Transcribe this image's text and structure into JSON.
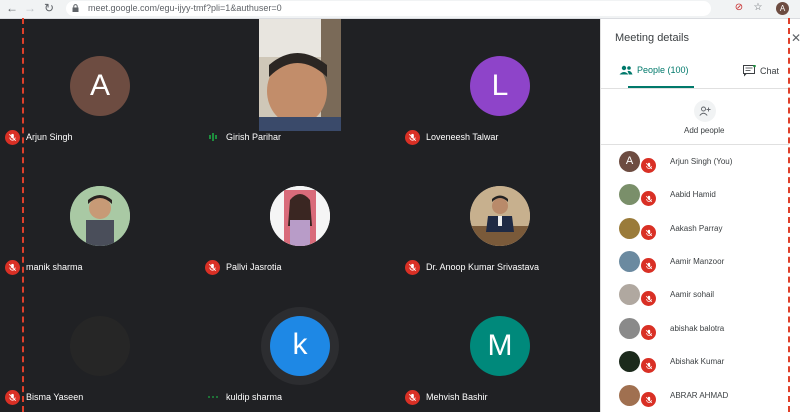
{
  "browser": {
    "url": "meet.google.com/egu-ijyy-tmf?pli=1&authuser=0",
    "profile_initial": "A"
  },
  "tiles": [
    {
      "name": "Arjun Singh",
      "initial": "A",
      "color": "#6d4c41",
      "mic": "off"
    },
    {
      "name": "Girish Parihar",
      "mic": "speaking"
    },
    {
      "name": "Loveneesh Talwar",
      "initial": "L",
      "color": "#8e44c9",
      "mic": "off"
    },
    {
      "name": "manik sharma",
      "mic": "off"
    },
    {
      "name": "Pallvi Jasrotia",
      "mic": "off"
    },
    {
      "name": "Dr. Anoop Kumar Srivastava",
      "mic": "off"
    },
    {
      "name": "Bisma Yaseen",
      "mic": "off"
    },
    {
      "name": "kuldip sharma",
      "initial": "k",
      "color": "#1e88e5",
      "mic": "active"
    },
    {
      "name": "Mehvish Bashir",
      "initial": "M",
      "color": "#00897b",
      "mic": "off"
    }
  ],
  "panel": {
    "title": "Meeting details",
    "tab_people": "People (100)",
    "tab_chat": "Chat",
    "add_people": "Add people",
    "people": [
      {
        "name": "Arjun Singh (You)",
        "initial": "A",
        "color": "#6d4c41"
      },
      {
        "name": "Aabid Hamid",
        "color": "#7a8f6a"
      },
      {
        "name": "Aakash Parray",
        "color": "#9a7b3a"
      },
      {
        "name": "Aamir Manzoor",
        "color": "#6b8aa0"
      },
      {
        "name": "Aamir sohail",
        "color": "#b0a8a0"
      },
      {
        "name": "abishak balotra",
        "color": "#8a8a8a"
      },
      {
        "name": "Abishak Kumar",
        "color": "#1c2a1c"
      },
      {
        "name": "ABRAR AHMAD",
        "color": "#a07050"
      }
    ]
  }
}
